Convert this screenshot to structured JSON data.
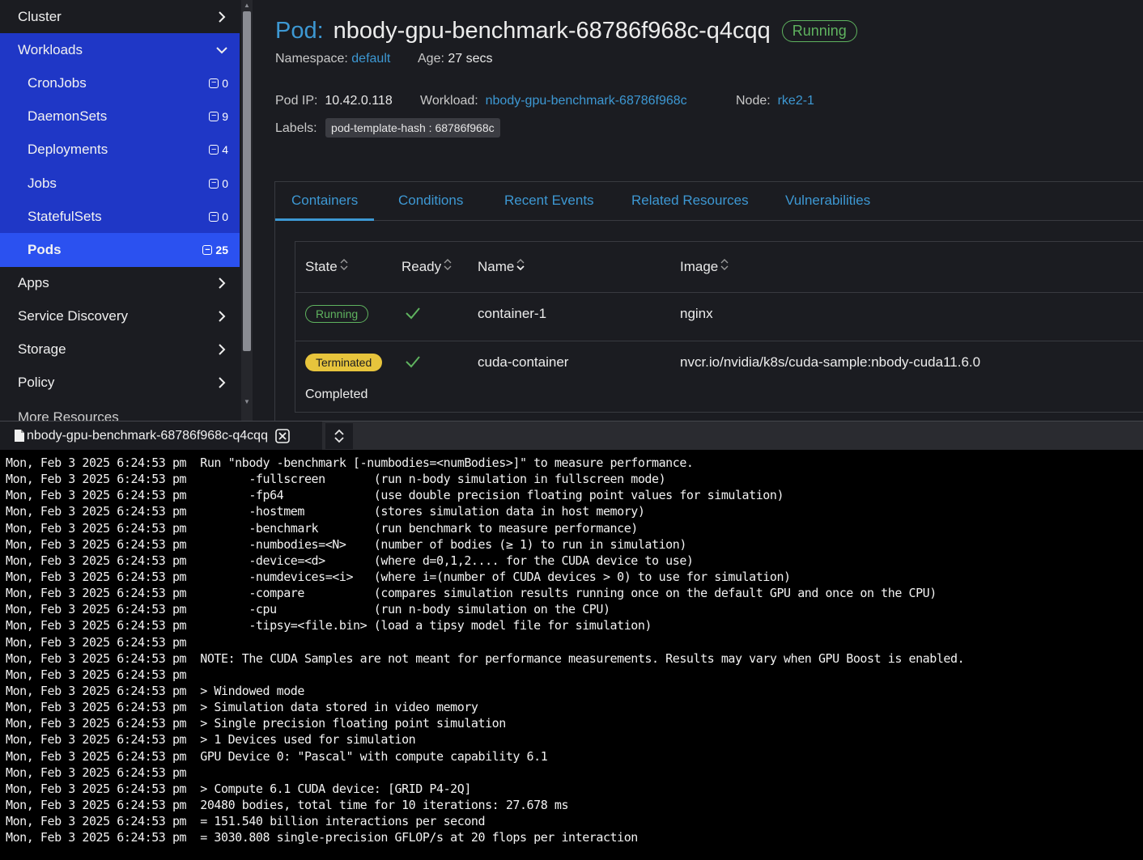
{
  "sidebar": {
    "groups_top": [
      {
        "label": "Cluster",
        "open": false
      }
    ],
    "workloads": {
      "label": "Workloads",
      "items": [
        {
          "label": "CronJobs",
          "count": "0"
        },
        {
          "label": "DaemonSets",
          "count": "9"
        },
        {
          "label": "Deployments",
          "count": "4"
        },
        {
          "label": "Jobs",
          "count": "0"
        },
        {
          "label": "StatefulSets",
          "count": "0"
        },
        {
          "label": "Pods",
          "count": "25",
          "active": true
        }
      ]
    },
    "groups_bottom": [
      {
        "label": "Apps"
      },
      {
        "label": "Service Discovery"
      },
      {
        "label": "Storage"
      },
      {
        "label": "Policy"
      }
    ],
    "cut_label": "More Resources"
  },
  "pod": {
    "prefix": "Pod:",
    "name": "nbody-gpu-benchmark-68786f968c-q4cqq",
    "status": "Running",
    "namespace_label": "Namespace:",
    "namespace": "default",
    "age_label": "Age:",
    "age": "27 secs",
    "ip_label": "Pod IP:",
    "ip": "10.42.0.118",
    "workload_label": "Workload:",
    "workload": "nbody-gpu-benchmark-68786f968c",
    "node_label": "Node:",
    "node": "rke2-1",
    "labels_label": "Labels:",
    "label_chip": "pod-template-hash : 68786f968c"
  },
  "tabs": [
    "Containers",
    "Conditions",
    "Recent Events",
    "Related Resources",
    "Vulnerabilities"
  ],
  "table": {
    "headers": [
      "State",
      "Ready",
      "Name",
      "Image"
    ],
    "rows": [
      {
        "state": "Running",
        "state_type": "running",
        "ready": true,
        "name": "container-1",
        "image": "nginx",
        "sub": ""
      },
      {
        "state": "Terminated",
        "state_type": "terminated",
        "ready": true,
        "name": "cuda-container",
        "image": "nvcr.io/nvidia/k8s/cuda-sample:nbody-cuda11.6.0",
        "sub": "Completed"
      }
    ]
  },
  "terminal": {
    "tab_title": "nbody-gpu-benchmark-68786f968c-q4cqq",
    "lines": [
      "Mon, Feb 3 2025 6:24:53 pm  Run \"nbody -benchmark [-numbodies=<numBodies>]\" to measure performance.",
      "Mon, Feb 3 2025 6:24:53 pm         -fullscreen       (run n-body simulation in fullscreen mode)",
      "Mon, Feb 3 2025 6:24:53 pm         -fp64             (use double precision floating point values for simulation)",
      "Mon, Feb 3 2025 6:24:53 pm         -hostmem          (stores simulation data in host memory)",
      "Mon, Feb 3 2025 6:24:53 pm         -benchmark        (run benchmark to measure performance)",
      "Mon, Feb 3 2025 6:24:53 pm         -numbodies=<N>    (number of bodies (≥ 1) to run in simulation)",
      "Mon, Feb 3 2025 6:24:53 pm         -device=<d>       (where d=0,1,2.... for the CUDA device to use)",
      "Mon, Feb 3 2025 6:24:53 pm         -numdevices=<i>   (where i=(number of CUDA devices > 0) to use for simulation)",
      "Mon, Feb 3 2025 6:24:53 pm         -compare          (compares simulation results running once on the default GPU and once on the CPU)",
      "Mon, Feb 3 2025 6:24:53 pm         -cpu              (run n-body simulation on the CPU)",
      "Mon, Feb 3 2025 6:24:53 pm         -tipsy=<file.bin> (load a tipsy model file for simulation)",
      "Mon, Feb 3 2025 6:24:53 pm",
      "Mon, Feb 3 2025 6:24:53 pm  NOTE: The CUDA Samples are not meant for performance measurements. Results may vary when GPU Boost is enabled.",
      "Mon, Feb 3 2025 6:24:53 pm",
      "Mon, Feb 3 2025 6:24:53 pm  > Windowed mode",
      "Mon, Feb 3 2025 6:24:53 pm  > Simulation data stored in video memory",
      "Mon, Feb 3 2025 6:24:53 pm  > Single precision floating point simulation",
      "Mon, Feb 3 2025 6:24:53 pm  > 1 Devices used for simulation",
      "Mon, Feb 3 2025 6:24:53 pm  GPU Device 0: \"Pascal\" with compute capability 6.1",
      "Mon, Feb 3 2025 6:24:53 pm",
      "Mon, Feb 3 2025 6:24:53 pm  > Compute 6.1 CUDA device: [GRID P4-2Q]",
      "Mon, Feb 3 2025 6:24:53 pm  20480 bodies, total time for 10 iterations: 27.678 ms",
      "Mon, Feb 3 2025 6:24:53 pm  = 151.540 billion interactions per second",
      "Mon, Feb 3 2025 6:24:53 pm  = 3030.808 single-precision GFLOP/s at 20 flops per interaction"
    ]
  },
  "colors": {
    "accent": "#3d98d3",
    "nav_open": "#1f37c6",
    "nav_active": "#2b51f0",
    "running": "#5fb35f",
    "terminated": "#e7c43c"
  }
}
